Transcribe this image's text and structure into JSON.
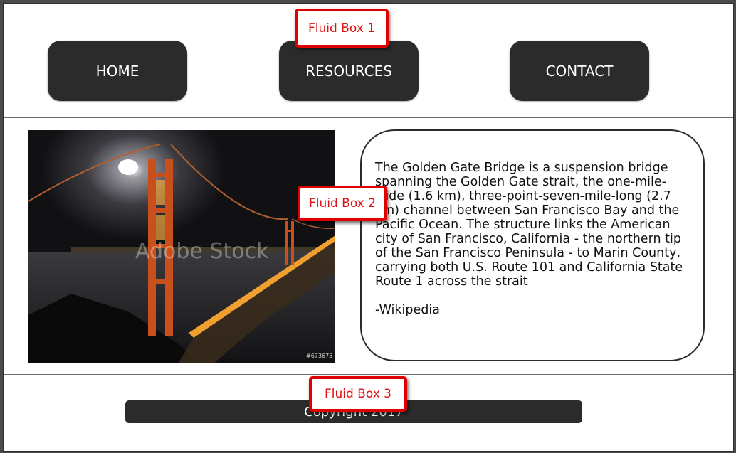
{
  "nav": {
    "home_label": "HOME",
    "resources_label": "RESOURCES",
    "contact_label": "CONTACT"
  },
  "content": {
    "image": {
      "watermark": "Adobe Stock",
      "stock_id": "#673675"
    },
    "description": "The Golden Gate Bridge is a suspension bridge spanning the Golden Gate strait, the one-mile-wide (1.6 km), three-point-seven-mile-long (2.7 km) channel between San Francisco Bay and the Pacific Ocean. The structure links the American city of San Francisco, California - the northern tip of the San Francisco Peninsula - to Marin County, carrying both U.S. Route 101 and California State Route 1 across the strait",
    "attribution": "-Wikipedia"
  },
  "footer": {
    "text": "Copyright 2017"
  },
  "callouts": {
    "box1": "Fluid Box 1",
    "box2": "Fluid Box 2",
    "box3": "Fluid Box 3"
  },
  "colors": {
    "button_bg": "#2b2b2b",
    "callout_red": "#e00000",
    "bridge_orange": "#c8501c"
  }
}
